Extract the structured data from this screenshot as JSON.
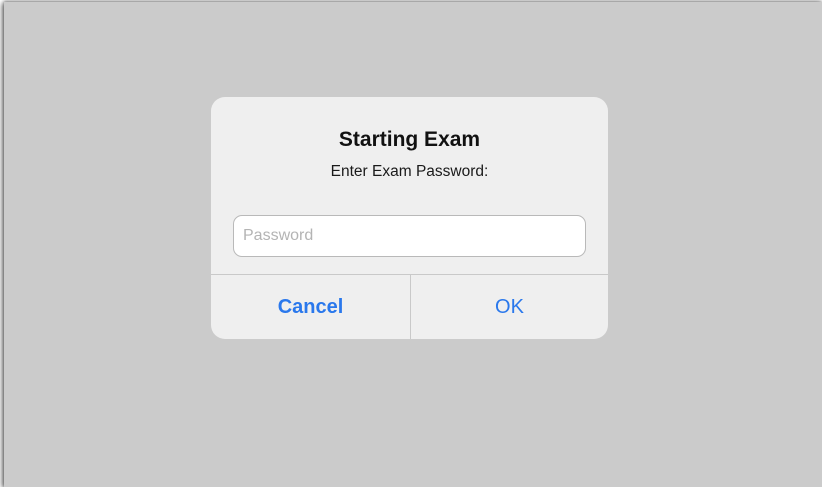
{
  "dialog": {
    "title": "Starting Exam",
    "message": "Enter Exam Password:",
    "password_field": {
      "placeholder": "Password",
      "value": ""
    },
    "buttons": {
      "cancel_label": "Cancel",
      "ok_label": "OK"
    }
  },
  "colors": {
    "backdrop": "#cbcbcb",
    "dialog_background": "#efefef",
    "button_text": "#2a78ec"
  }
}
